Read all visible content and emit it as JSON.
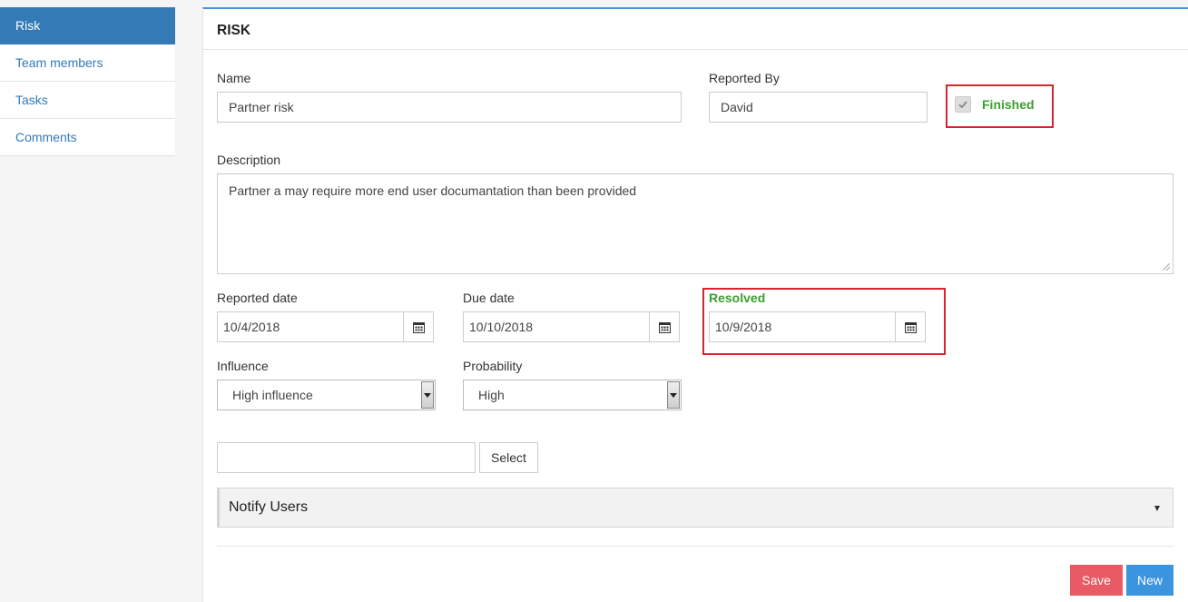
{
  "sidebar": {
    "items": [
      {
        "label": "Risk"
      },
      {
        "label": "Team members"
      },
      {
        "label": "Tasks"
      },
      {
        "label": "Comments"
      }
    ]
  },
  "panel": {
    "title": "RISK"
  },
  "form": {
    "name_label": "Name",
    "name_value": "Partner risk",
    "reported_by_label": "Reported By",
    "reported_by_value": "David",
    "finished_label": "Finished",
    "description_label": "Description",
    "description_value": "Partner a may require more end user documantation than been provided",
    "reported_date_label": "Reported date",
    "reported_date_value": "10/4/2018",
    "due_date_label": "Due date",
    "due_date_value": "10/10/2018",
    "resolved_label": "Resolved",
    "resolved_value": "10/9/2018",
    "influence_label": "Influence",
    "influence_value": "High influence",
    "probability_label": "Probability",
    "probability_value": "High",
    "select_input_value": "",
    "select_button_label": "Select"
  },
  "notify": {
    "label": "Notify Users"
  },
  "actions": {
    "save_label": "Save",
    "new_label": "New"
  },
  "colors": {
    "accent": "#337ab7",
    "highlight_red": "#d9232e",
    "success_green": "#3c9e2f",
    "save": "#e85a64",
    "new": "#3a94de"
  }
}
